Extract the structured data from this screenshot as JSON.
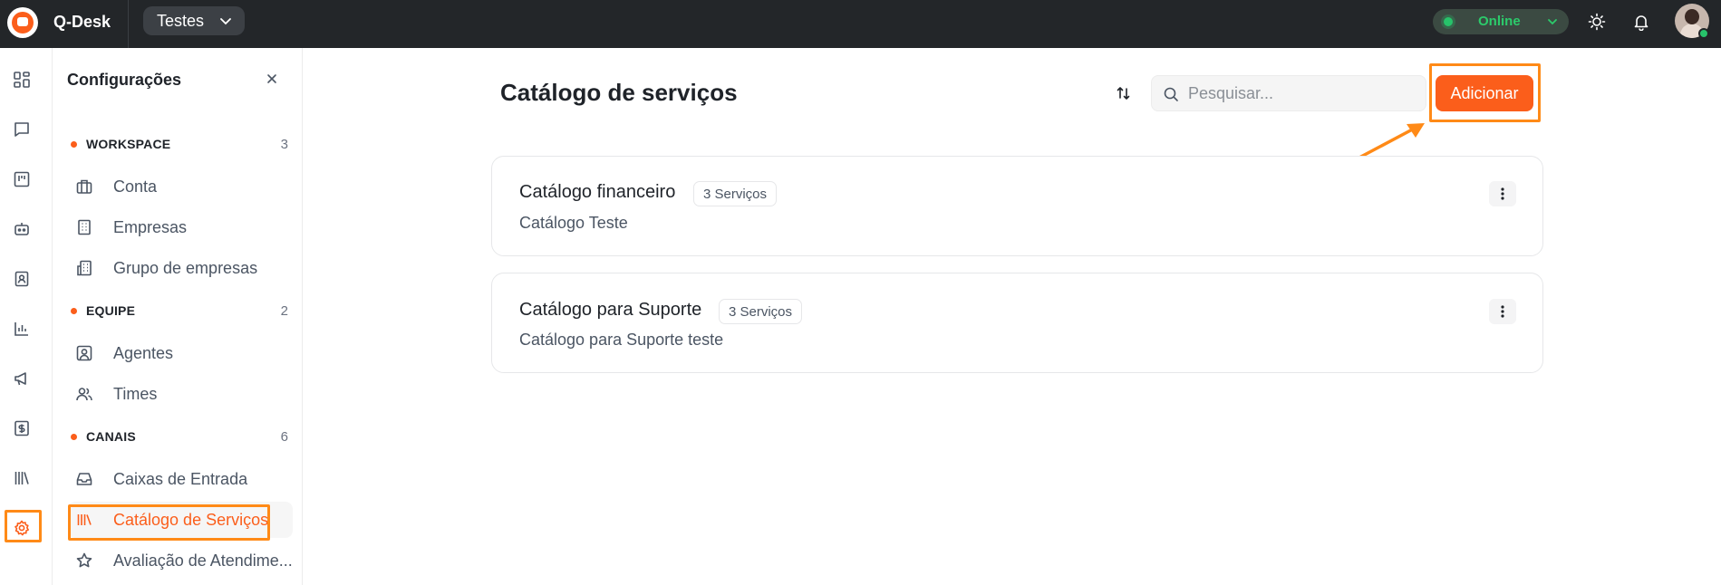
{
  "topbar": {
    "brand": "Q-Desk",
    "workspace": "Testes",
    "status": "Online"
  },
  "sidebar_settings": {
    "title": "Configurações",
    "sections": [
      {
        "label": "WORKSPACE",
        "count": "3"
      },
      {
        "label": "EQUIPE",
        "count": "2"
      },
      {
        "label": "CANAIS",
        "count": "6"
      }
    ],
    "items": [
      {
        "label": "Conta",
        "icon": "briefcase-icon"
      },
      {
        "label": "Empresas",
        "icon": "building-icon"
      },
      {
        "label": "Grupo de empresas",
        "icon": "buildings-icon"
      },
      {
        "label": "Agentes",
        "icon": "user-square-icon"
      },
      {
        "label": "Times",
        "icon": "users-icon"
      },
      {
        "label": "Caixas de Entrada",
        "icon": "inbox-icon"
      },
      {
        "label": "Catálogo de Serviços",
        "icon": "library-icon",
        "active": true
      },
      {
        "label": "Avaliação de Atendime...",
        "icon": "star-icon"
      }
    ]
  },
  "main": {
    "title": "Catálogo de serviços",
    "search_placeholder": "Pesquisar...",
    "add_label": "Adicionar",
    "catalogs": [
      {
        "name": "Catálogo financeiro",
        "badge": "3 Serviços",
        "description": "Catálogo Teste"
      },
      {
        "name": "Catálogo para Suporte",
        "badge": "3 Serviços",
        "description": "Catálogo para Suporte teste"
      }
    ]
  },
  "colors": {
    "accent": "#fb5e1b",
    "highlight": "#ff8a17",
    "topbar": "#232629",
    "online": "#27c26a"
  }
}
